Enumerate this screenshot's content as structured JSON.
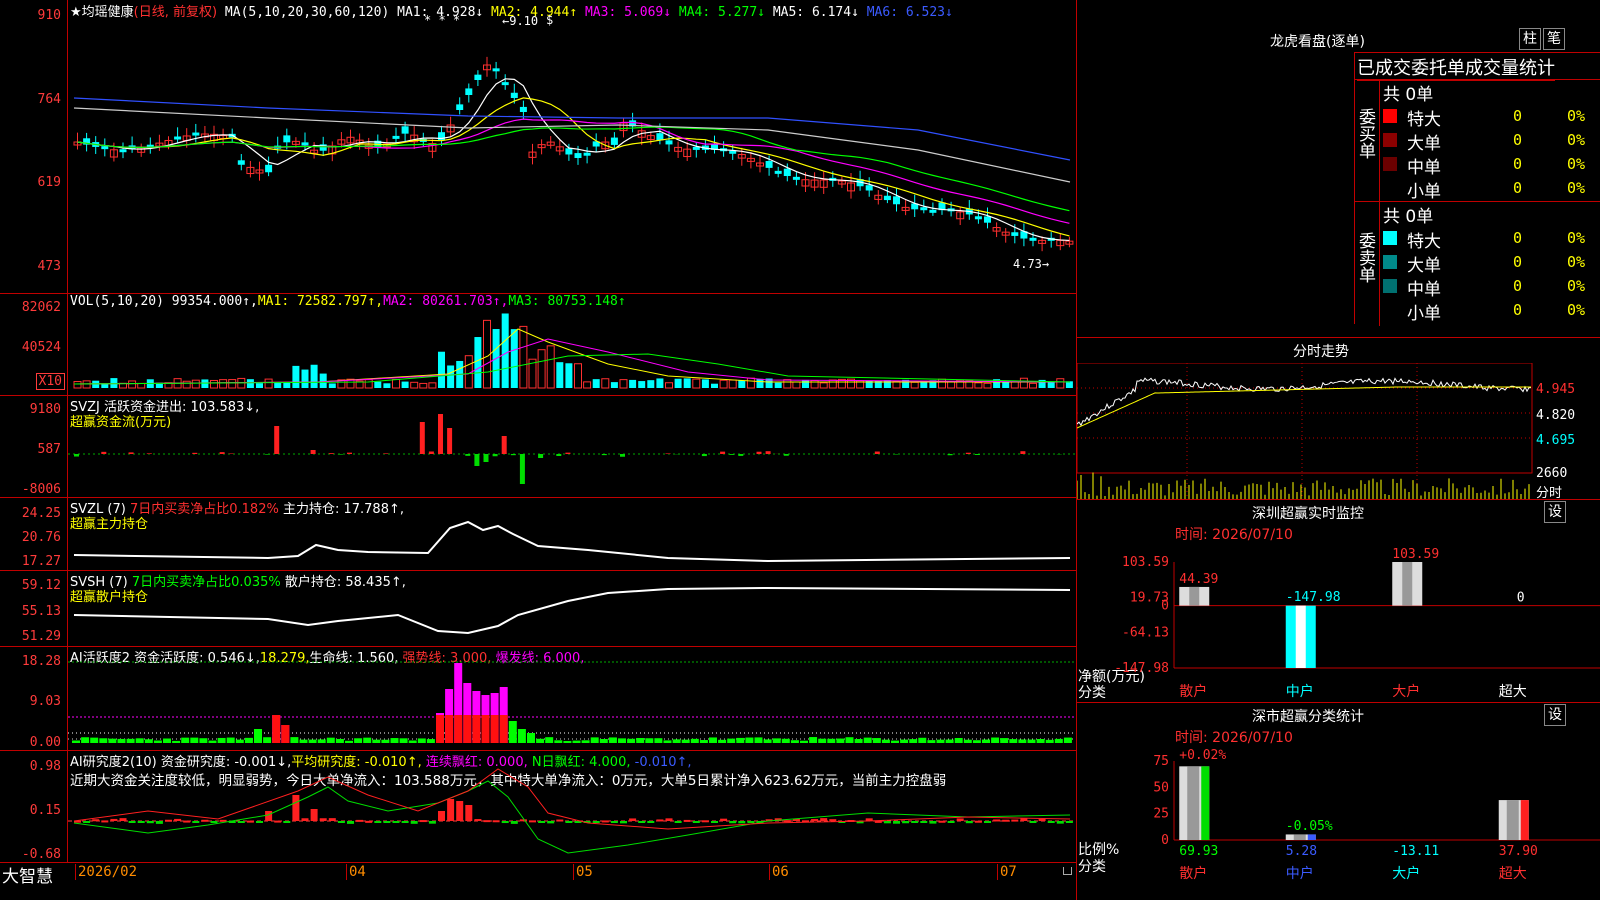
{
  "price_panel": {
    "star": "★",
    "stock_name": "均瑶健康",
    "mode": "(日线, 前复权)",
    "ma_params": "MA(5,10,20,30,60,120)",
    "ma1": "MA1: 4.928↓",
    "ma2": "MA2: 4.944↑",
    "ma3": "MA3: 5.069↓",
    "ma4": "MA4: 5.277↓",
    "ma5": "MA5: 6.174↓",
    "ma6": "MA6: 6.523↓",
    "y_ticks": [
      "910",
      "764",
      "619",
      "473"
    ],
    "high_marker": "9.10",
    "low_marker": "4.73",
    "star_marks": "* * *",
    "dollar_mark": "$"
  },
  "vol_panel": {
    "header": "VOL(5,10,20)",
    "value": "99354.000↑,",
    "ma1": "MA1: 72582.797↑,",
    "ma2": "MA2: 80261.703↑,",
    "ma3": "MA3: 80753.148↑",
    "y_ticks": [
      "82062",
      "40524"
    ],
    "unit_badge": "X10"
  },
  "svzj_panel": {
    "header": "SVZJ  活跃资金进出: 103.583↓,",
    "subtitle": "超赢资金流(万元)",
    "y_ticks": [
      "9180",
      "587",
      "-8006"
    ]
  },
  "svzl_panel": {
    "header1": "SVZL (7)",
    "header2": "7日内买卖净占比0.182%",
    "header3": "主力持仓: 17.788↑,",
    "subtitle": "超赢主力持仓",
    "y_ticks": [
      "24.25",
      "20.76",
      "17.27"
    ]
  },
  "svsh_panel": {
    "header1": "SVSH (7)",
    "header2": "7日内买卖净占比0.035%",
    "header3": "散户持仓: 58.435↑,",
    "subtitle": "超赢散户持仓",
    "y_ticks": [
      "59.12",
      "55.13",
      "51.29"
    ]
  },
  "ai_active_panel": {
    "h1": "AI活跃度2",
    "h2": "资金活跃度: 0.546↓,",
    "h3": "18.279,",
    "h4": "生命线: 1.560,",
    "h5": "强势线: 3.000,",
    "h6": "爆发线: 6.000,",
    "y_ticks": [
      "18.28",
      "9.03",
      "0.00"
    ]
  },
  "ai_research_panel": {
    "h1": "AI研究度2(10)",
    "h2": "资金研究度: -0.001↓,",
    "h3": "平均研究度: -0.010↑,",
    "h4": "连续飘红: 0.000,",
    "h5": "N日飘红: 4.000,",
    "h6": "-0.010↑,",
    "note": "近期大资金关注度较低，明显弱势，今日大单净流入：103.588万元，其中特大单净流入：0万元，大单5日累计净入623.62万元，当前主力控盘弱",
    "y_ticks": [
      "0.98",
      "0.15",
      "-0.68"
    ]
  },
  "date_axis": {
    "brand": "大智慧",
    "labels": [
      "2026/02",
      "04",
      "05",
      "06",
      "07"
    ]
  },
  "dragon_tiger": {
    "title": "龙虎看盘(逐单)",
    "btn_bar": "柱",
    "btn_pen": "笔",
    "tabs": "已成交委托单成交量统计",
    "buy_label": "委买单",
    "sell_label": "委卖单",
    "buy_total": "共 0单",
    "sell_total": "共 0单",
    "buy_rows": [
      {
        "name": "特大",
        "count": "0",
        "pct": "0%",
        "color": "#ff0000"
      },
      {
        "name": "大单",
        "count": "0",
        "pct": "0%",
        "color": "#8b0000"
      },
      {
        "name": "中单",
        "count": "0",
        "pct": "0%",
        "color": "#6b0000"
      },
      {
        "name": "小单",
        "count": "0",
        "pct": "0%",
        "color": ""
      }
    ],
    "sell_rows": [
      {
        "name": "特大",
        "count": "0",
        "pct": "0%",
        "color": "#00ffff"
      },
      {
        "name": "大单",
        "count": "0",
        "pct": "0%",
        "color": "#008b8b"
      },
      {
        "name": "中单",
        "count": "0",
        "pct": "0%",
        "color": "#007070"
      },
      {
        "name": "小单",
        "count": "0",
        "pct": "0%",
        "color": ""
      }
    ]
  },
  "intraday": {
    "title": "分时走势",
    "price_ticks": [
      "4.945",
      "4.820",
      "4.695"
    ],
    "vol_tick": "2660",
    "vol_label": "分时"
  },
  "realtime_monitor": {
    "title": "深圳超赢实时监控",
    "btn": "设",
    "time": "时间: 2026/07/10",
    "y_ticks": [
      "103.59",
      "19.73",
      "0",
      "-64.13",
      "-147.98"
    ],
    "ylabel1": "净额(万元)",
    "ylabel2": "分类",
    "bar_labels": [
      "44.39",
      "-147.98",
      "103.59",
      "0"
    ],
    "categories": [
      "散户",
      "中户",
      "大户",
      "超大"
    ]
  },
  "class_stats": {
    "title": "深市超赢分类统计",
    "btn": "设",
    "time": "时间: 2026/07/10",
    "y_ticks": [
      "75",
      "50",
      "25",
      "0"
    ],
    "ylabel1": "比例%",
    "ylabel2": "分类",
    "top_labels": [
      "+0.02%",
      "-0.05%"
    ],
    "bottom_values": [
      "69.93",
      "5.28",
      "-13.11",
      "37.90"
    ],
    "categories": [
      "散户",
      "中户",
      "大户",
      "超大"
    ]
  },
  "chart_data": [
    {
      "type": "bar",
      "title": "深圳超赢实时监控",
      "ylabel": "净额(万元)",
      "categories": [
        "散户",
        "中户",
        "大户",
        "超大"
      ],
      "values": [
        44.39,
        -147.98,
        103.59,
        0
      ],
      "ylim": [
        -147.98,
        103.59
      ]
    },
    {
      "type": "bar",
      "title": "深市超赢分类统计",
      "ylabel": "比例%",
      "categories": [
        "散户",
        "中户",
        "大户",
        "超大"
      ],
      "values": [
        69.93,
        5.28,
        -13.11,
        37.9
      ],
      "ylim": [
        0,
        75
      ]
    }
  ]
}
